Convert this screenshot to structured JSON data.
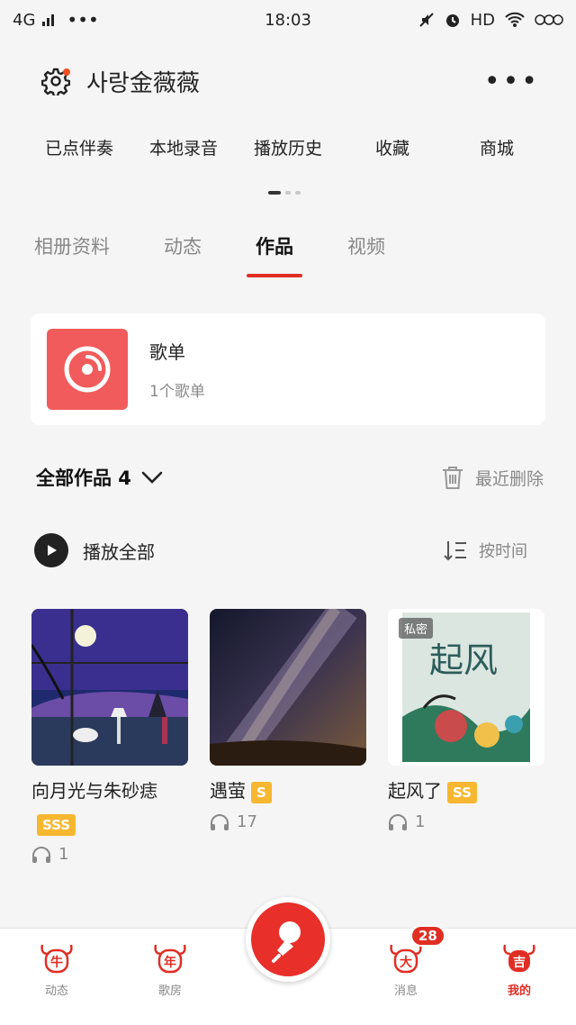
{
  "status_bar": {
    "network": "4G",
    "time": "18:03",
    "hd": "HD"
  },
  "header": {
    "username": "사랑金薇薇"
  },
  "quick_menu": {
    "items": [
      "已点伴奏",
      "本地录音",
      "播放历史",
      "收藏",
      "商城"
    ]
  },
  "profile_tabs": {
    "items": [
      "相册资料",
      "动态",
      "作品",
      "视频"
    ],
    "active": "作品"
  },
  "playlist_card": {
    "title": "歌单",
    "subtitle": "1个歌单"
  },
  "works": {
    "title": "全部作品 4",
    "recent_deleted": "最近删除",
    "play_all": "播放全部",
    "sort": "按时间"
  },
  "work_items": [
    {
      "title": "向月光与朱砂痣",
      "badge": "SSS",
      "plays": "1"
    },
    {
      "title": "遇萤",
      "badge": "S",
      "plays": "17"
    },
    {
      "title": "起风了",
      "badge": "SS",
      "plays": "1",
      "tag": "私密"
    }
  ],
  "bottom_nav": {
    "items": [
      {
        "label": "动态",
        "glyph": "牛"
      },
      {
        "label": "歌房",
        "glyph": "年"
      },
      {
        "label": "消息",
        "glyph": "大",
        "badge": "28"
      },
      {
        "label": "我的",
        "glyph": "吉"
      }
    ]
  },
  "colors": {
    "accent": "#e02e24",
    "badge": "#f7b731",
    "playlist_cover": "#f25b5b"
  }
}
